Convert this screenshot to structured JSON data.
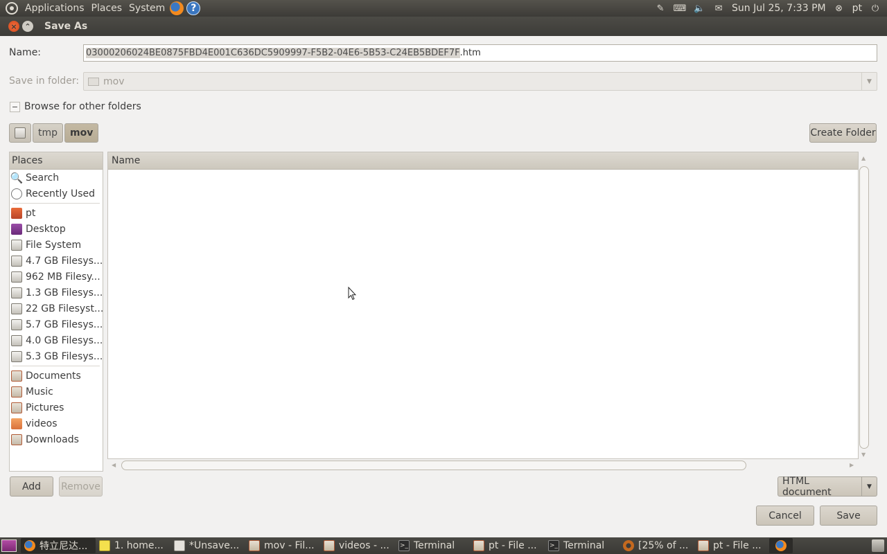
{
  "top_panel": {
    "menus": [
      "Applications",
      "Places",
      "System"
    ],
    "clock": "Sun Jul 25,  7:33 PM",
    "user": "pt"
  },
  "window": {
    "title": "Save As"
  },
  "form": {
    "name_label": "Name:",
    "name_selected": "03000206024BE0875FBD4E001C636DC5909997-F5B2-04E6-5B53-C24EB5BDEF7F",
    "name_suffix": ".htm",
    "folder_label": "Save in folder:",
    "folder_value": "mov",
    "browse_label": "Browse for other folders",
    "browse_expander": "−"
  },
  "path_bar": {
    "crumbs": [
      "tmp",
      "mov"
    ],
    "create_folder": "Create Folder"
  },
  "places": {
    "header": "Places",
    "items": [
      {
        "label": "Search",
        "icon": "search-icon"
      },
      {
        "label": "Recently Used",
        "icon": "recent-icon"
      },
      {
        "label": "pt",
        "icon": "home-folder-icon"
      },
      {
        "label": "Desktop",
        "icon": "desktop-icon"
      },
      {
        "label": "File System",
        "icon": "drive-icon"
      },
      {
        "label": "4.7 GB Filesys...",
        "icon": "drive-icon"
      },
      {
        "label": "962 MB Filesy...",
        "icon": "drive-icon"
      },
      {
        "label": "1.3 GB Filesys...",
        "icon": "drive-icon"
      },
      {
        "label": "22 GB Filesyst...",
        "icon": "drive-icon"
      },
      {
        "label": "5.7 GB Filesys...",
        "icon": "drive-icon"
      },
      {
        "label": "4.0 GB Filesys...",
        "icon": "drive-icon"
      },
      {
        "label": "5.3 GB Filesys...",
        "icon": "drive-icon"
      },
      {
        "label": "Documents",
        "icon": "documents-folder-icon"
      },
      {
        "label": "Music",
        "icon": "music-folder-icon"
      },
      {
        "label": "Pictures",
        "icon": "pictures-folder-icon"
      },
      {
        "label": "videos",
        "icon": "folder-icon"
      },
      {
        "label": "Downloads",
        "icon": "downloads-folder-icon"
      }
    ]
  },
  "file_list": {
    "column_name": "Name"
  },
  "buttons": {
    "add": "Add",
    "remove": "Remove",
    "filter": "HTML document",
    "cancel": "Cancel",
    "save": "Save"
  },
  "taskbar": {
    "tasks": [
      {
        "label": "特立尼达...",
        "icon": "firefox-icon",
        "active": true
      },
      {
        "label": "1. home...",
        "icon": "notes-icon"
      },
      {
        "label": "*Unsave...",
        "icon": "text-editor-icon"
      },
      {
        "label": "mov - Fil...",
        "icon": "folder-icon"
      },
      {
        "label": "videos - ...",
        "icon": "folder-icon"
      },
      {
        "label": "Terminal",
        "icon": "terminal-icon"
      },
      {
        "label": "pt - File ...",
        "icon": "folder-icon"
      },
      {
        "label": "Terminal",
        "icon": "terminal-icon"
      },
      {
        "label": "[25% of ...",
        "icon": "download-icon"
      },
      {
        "label": "pt - File ...",
        "icon": "folder-icon"
      }
    ]
  }
}
